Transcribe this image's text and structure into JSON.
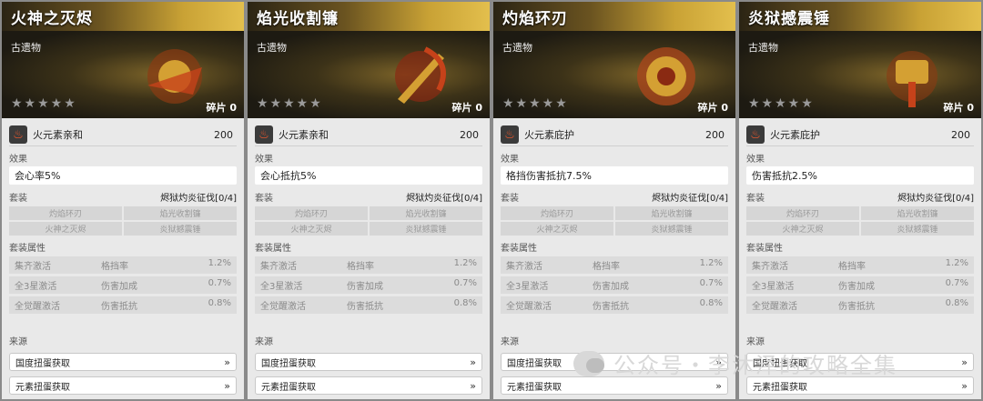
{
  "cards": [
    {
      "title": "火神之灭烬",
      "rarity": "古遗物",
      "stars": "★★★★★",
      "fragments": "碎片 0",
      "main_stat": "火元素亲和",
      "main_value": "200",
      "effect_label": "效果",
      "effect": "会心率5%",
      "set_label": "套装",
      "set_count": "烬狱灼炎征伐[0/4]",
      "set_items": [
        "灼焰环刃",
        "焰光收割镰",
        "火神之灭烬",
        "炎狱撼震锤"
      ],
      "attr_label": "套装属性",
      "attrs": [
        {
          "cond": "集齐激活",
          "name": "格挡率",
          "val": "1.2%"
        },
        {
          "cond": "全3星激活",
          "name": "伤害加成",
          "val": "0.7%"
        },
        {
          "cond": "全觉醒激活",
          "name": "伤害抵抗",
          "val": "0.8%"
        }
      ],
      "src_label": "来源",
      "sources": [
        "国度扭蛋获取",
        "元素扭蛋获取"
      ]
    },
    {
      "title": "焰光收割镰",
      "rarity": "古遗物",
      "stars": "★★★★★",
      "fragments": "碎片 0",
      "main_stat": "火元素亲和",
      "main_value": "200",
      "effect_label": "效果",
      "effect": "会心抵抗5%",
      "set_label": "套装",
      "set_count": "烬狱灼炎征伐[0/4]",
      "set_items": [
        "灼焰环刃",
        "焰光收割镰",
        "火神之灭烬",
        "炎狱撼震锤"
      ],
      "attr_label": "套装属性",
      "attrs": [
        {
          "cond": "集齐激活",
          "name": "格挡率",
          "val": "1.2%"
        },
        {
          "cond": "全3星激活",
          "name": "伤害加成",
          "val": "0.7%"
        },
        {
          "cond": "全觉醒激活",
          "name": "伤害抵抗",
          "val": "0.8%"
        }
      ],
      "src_label": "来源",
      "sources": [
        "国度扭蛋获取",
        "元素扭蛋获取"
      ]
    },
    {
      "title": "灼焰环刃",
      "rarity": "古遗物",
      "stars": "★★★★★",
      "fragments": "碎片 0",
      "main_stat": "火元素庇护",
      "main_value": "200",
      "effect_label": "效果",
      "effect": "格挡伤害抵抗7.5%",
      "set_label": "套装",
      "set_count": "烬狱灼炎征伐[0/4]",
      "set_items": [
        "灼焰环刃",
        "焰光收割镰",
        "火神之灭烬",
        "炎狱撼震锤"
      ],
      "attr_label": "套装属性",
      "attrs": [
        {
          "cond": "集齐激活",
          "name": "格挡率",
          "val": "1.2%"
        },
        {
          "cond": "全3星激活",
          "name": "伤害加成",
          "val": "0.7%"
        },
        {
          "cond": "全觉醒激活",
          "name": "伤害抵抗",
          "val": "0.8%"
        }
      ],
      "src_label": "来源",
      "sources": [
        "国度扭蛋获取",
        "元素扭蛋获取"
      ]
    },
    {
      "title": "炎狱撼震锤",
      "rarity": "古遗物",
      "stars": "★★★★★",
      "fragments": "碎片 0",
      "main_stat": "火元素庇护",
      "main_value": "200",
      "effect_label": "效果",
      "effect": "伤害抵抗2.5%",
      "set_label": "套装",
      "set_count": "烬狱灼炎征伐[0/4]",
      "set_items": [
        "灼焰环刃",
        "焰光收割镰",
        "火神之灭烬",
        "炎狱撼震锤"
      ],
      "attr_label": "套装属性",
      "attrs": [
        {
          "cond": "集齐激活",
          "name": "格挡率",
          "val": "1.2%"
        },
        {
          "cond": "全3星激活",
          "name": "伤害加成",
          "val": "0.7%"
        },
        {
          "cond": "全觉醒激活",
          "name": "伤害抵抗",
          "val": "0.8%"
        }
      ],
      "src_label": "来源",
      "sources": [
        "国度扭蛋获取",
        "元素扭蛋获取"
      ]
    }
  ],
  "watermark": "公众号・李沐泽的攻略全集",
  "chevron_glyph": "»",
  "fire_glyph": "♨"
}
